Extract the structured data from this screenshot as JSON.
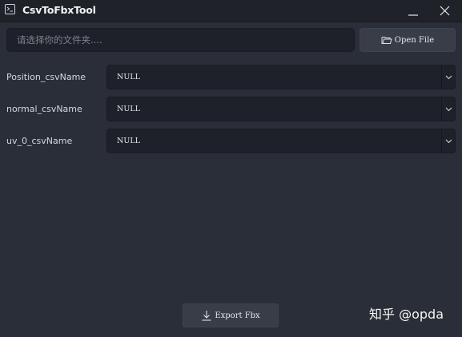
{
  "window": {
    "title": "CsvToFbxTool",
    "icon": "terminal-icon",
    "controls": [
      "minimize-icon",
      "close-icon"
    ]
  },
  "toolbar": {
    "path_placeholder": "请选择你的文件夹....",
    "open_label": "Open File",
    "open_icon": "folder-icon"
  },
  "fields": [
    {
      "label": "Position_csvName",
      "value": "NULL"
    },
    {
      "label": "normal_csvName",
      "value": "NULL"
    },
    {
      "label": "uv_0_csvName",
      "value": "NULL"
    }
  ],
  "footer": {
    "export_label": "Export Fbx",
    "export_icon": "download-icon",
    "watermark": "知乎 @opda"
  },
  "colors": {
    "background": "#2a2e38",
    "titlebar": "#1f2229",
    "input_bg": "#1e2129",
    "button_bg": "#383d48",
    "text": "#e4e6ea"
  }
}
